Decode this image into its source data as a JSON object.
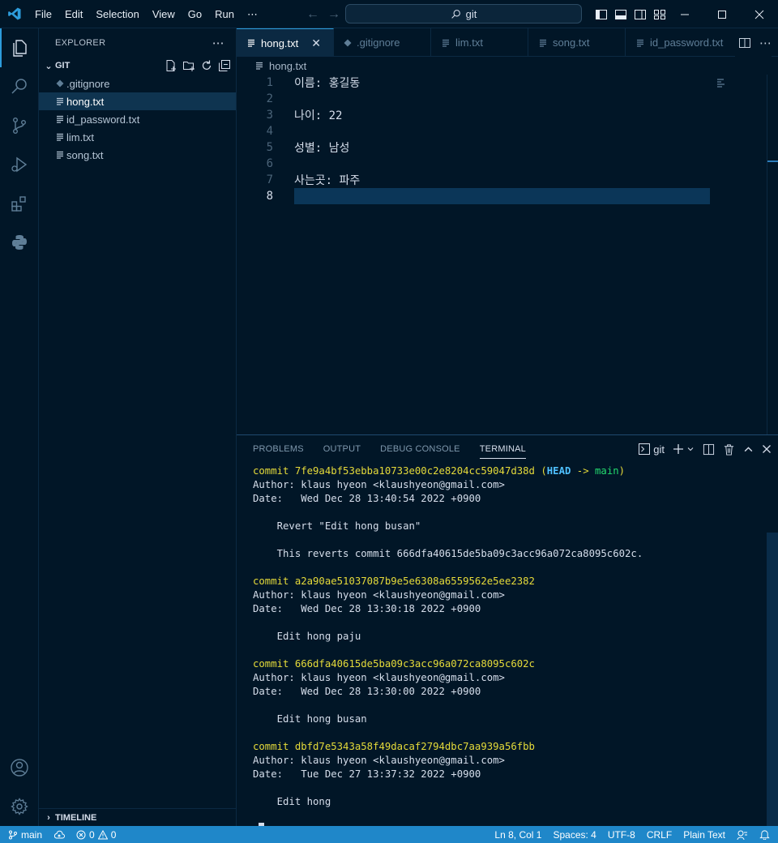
{
  "menu": [
    "File",
    "Edit",
    "Selection",
    "View",
    "Go",
    "Run",
    "⋯"
  ],
  "command_center": {
    "label": "git"
  },
  "sidebar": {
    "title": "EXPLORER",
    "more": "⋯",
    "section": "GIT",
    "files": [
      ".gitignore",
      "hong.txt",
      "id_password.txt",
      "lim.txt",
      "song.txt"
    ],
    "selected_file": "hong.txt",
    "timeline": "TIMELINE"
  },
  "tabs": [
    {
      "label": "hong.txt",
      "active": true
    },
    {
      "label": ".gitignore"
    },
    {
      "label": "lim.txt"
    },
    {
      "label": "song.txt"
    },
    {
      "label": "id_password.txt"
    }
  ],
  "breadcrumb": "hong.txt",
  "editor": {
    "lines": [
      "이름: 홍길동",
      "",
      "나이: 22",
      "",
      "성별: 남성",
      "",
      "사는곳: 파주",
      ""
    ],
    "line_numbers": [
      "1",
      "2",
      "3",
      "4",
      "5",
      "6",
      "7",
      "8"
    ],
    "current_line": 8
  },
  "panel": {
    "tabs": [
      "PROBLEMS",
      "OUTPUT",
      "DEBUG CONSOLE",
      "TERMINAL"
    ],
    "active_tab": "TERMINAL",
    "terminal_name": "git",
    "commits": [
      {
        "hash": "commit 7fe9a4bf53ebba10733e00c2e8204cc59047d38d",
        "author": "Author: klaus hyeon <klaushyeon@gmail.com>",
        "date": "Date:   Wed Dec 28 13:40:54 2022 +0900",
        "msg1": "    Revert \"Edit hong busan\"",
        "msg2": "    This reverts commit 666dfa40615de5ba09c3acc96a072ca8095c602c."
      },
      {
        "hash": "commit a2a90ae51037087b9e5e6308a6559562e5ee2382",
        "author": "Author: klaus hyeon <klaushyeon@gmail.com>",
        "date": "Date:   Wed Dec 28 13:30:18 2022 +0900",
        "msg1": "    Edit hong paju"
      },
      {
        "hash": "commit 666dfa40615de5ba09c3acc96a072ca8095c602c",
        "author": "Author: klaus hyeon <klaushyeon@gmail.com>",
        "date": "Date:   Wed Dec 28 13:30:00 2022 +0900",
        "msg1": "    Edit hong busan"
      },
      {
        "hash": "commit dbfd7e5343a58f49dacaf2794dbc7aa939a56fbb",
        "author": "Author: klaus hyeon <klaushyeon@gmail.com>",
        "date": "Date:   Tue Dec 27 13:37:32 2022 +0900",
        "msg1": "    Edit hong"
      }
    ],
    "head_ref": {
      "open": "(",
      "head": "HEAD",
      "arrow": " -> ",
      "branch": "main",
      "close": ")"
    },
    "prompt": ":"
  },
  "status": {
    "branch": "main",
    "errors": "0",
    "warnings": "0",
    "position": "Ln 8, Col 1",
    "spaces": "Spaces: 4",
    "encoding": "UTF-8",
    "eol": "CRLF",
    "language": "Plain Text"
  },
  "colors": {
    "accent": "#1f87c9",
    "background": "#011627",
    "commit_hash": "#e6db3a",
    "head": "#4fc1ff",
    "branch": "#22da6e"
  }
}
